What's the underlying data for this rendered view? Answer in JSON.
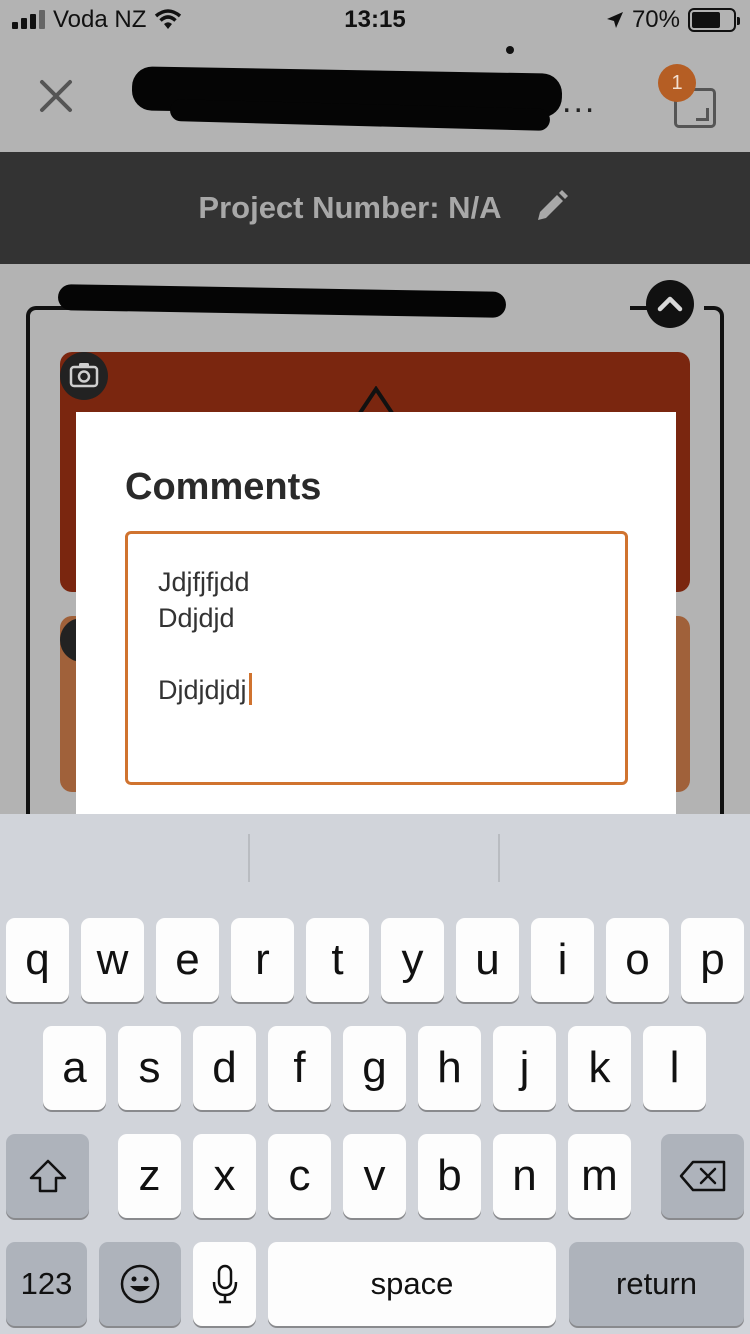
{
  "status_bar": {
    "carrier": "Voda NZ",
    "time": "13:15",
    "battery": "70%"
  },
  "nav": {
    "badge_count": "1",
    "more": "..."
  },
  "project": {
    "label": "Project Number: N/A"
  },
  "modal": {
    "title": "Comments",
    "lines": [
      "Jdjfjfjdd",
      "Ddjdjd",
      "",
      "Djdjdjdj"
    ]
  },
  "keyboard": {
    "row1": [
      "q",
      "w",
      "e",
      "r",
      "t",
      "y",
      "u",
      "i",
      "o",
      "p"
    ],
    "row2": [
      "a",
      "s",
      "d",
      "f",
      "g",
      "h",
      "j",
      "k",
      "l"
    ],
    "row3": [
      "z",
      "x",
      "c",
      "v",
      "b",
      "n",
      "m"
    ],
    "numbers": "123",
    "space": "space",
    "return": "return"
  },
  "icons": [
    "signal-icon",
    "wifi-icon",
    "location-arrow-icon",
    "battery-icon",
    "close-icon",
    "gallery-badge-icon",
    "pencil-icon",
    "chevron-up-icon",
    "camera-icon",
    "shift-icon",
    "backspace-icon",
    "emoji-icon",
    "microphone-icon"
  ],
  "colors": {
    "accent": "#d0732f",
    "badge": "#b55e24",
    "dark_bar": "#333333",
    "card1": "#7a260f",
    "card2": "#a0613a"
  }
}
